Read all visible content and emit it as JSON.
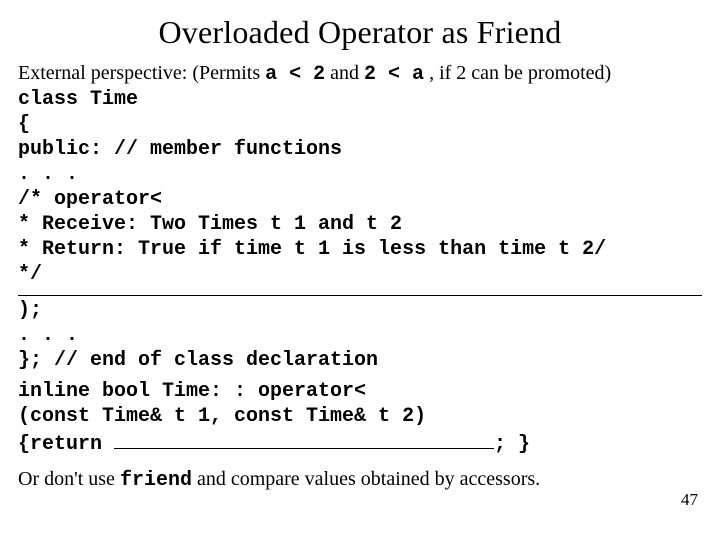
{
  "title": "Overloaded Operator as Friend",
  "line_intro_prefix": "External perspective: (Permits ",
  "code_a_lt_2": "a < 2",
  "line_intro_mid": " and ",
  "code_2_lt_a": "2 < a",
  "line_intro_suffix": " , if 2 can be promoted)",
  "code": {
    "l1": "class Time",
    "l2": "{",
    "l3": "public:   // member functions",
    "l4": " . . .",
    "l5": " /* operator<",
    "l6": "  * Receive:  Two Times t 1 and t 2",
    "l7": "  * Return:   True if time t 1 is less than time t 2/",
    "l8": "  */",
    "l9": ");",
    "l10": " . . .",
    "l11": "}; // end of class declaration",
    "l12": "inline bool Time: : operator<",
    "l13": "                   (const Time& t 1, const Time& t 2)",
    "ret_open": "{return ",
    "ret_close": "; }"
  },
  "footer_prefix": "Or don't use ",
  "footer_code": "friend",
  "footer_suffix": " and compare values obtained by accessors.",
  "pagenum": "47"
}
